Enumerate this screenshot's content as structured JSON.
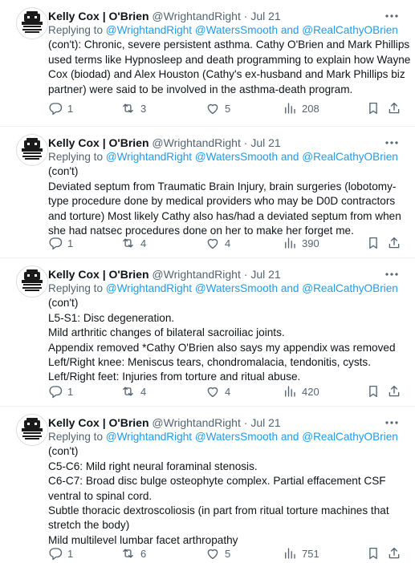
{
  "author": {
    "name": "Kelly Cox | O'Brien",
    "handle": "@WrightandRight",
    "separator": "·",
    "date": "Jul 21"
  },
  "reply": {
    "prefix": "Replying to",
    "mention1": "@WrightandRight",
    "mention2": "@WatersSmooth",
    "and": "and",
    "mention3": "@RealCathyOBrien"
  },
  "icons": {
    "more": "more-dots-icon",
    "reply": "reply-bubble-icon",
    "retweet": "retweet-icon",
    "like": "heart-icon",
    "views": "bar-chart-icon",
    "bookmark": "bookmark-icon",
    "share": "share-icon"
  },
  "colors": {
    "accent": "#1d9bf0",
    "muted": "#536471",
    "text": "#0f1419"
  },
  "tweets": [
    {
      "lines": [
        "(con't): Chronic, severe persistent asthma. Cathy O'Brien and Mark Phillips",
        "used terms like Hypnosleep and death programming to explain how Wayne",
        "Cox (biodad) and Alex Houston (Cathy's ex-husband and Mark Phillips biz",
        "partner) were said to be involved in the asthma-death program."
      ],
      "replies": "1",
      "retweets": "3",
      "likes": "5",
      "views": "208"
    },
    {
      "lines": [
        "(con't)",
        "Deviated septum from Traumatic Brain Injury, brain surgeries (lobotomy-",
        "type procedure done by medical providers who may be D0D contractors",
        "and torture) Most likely Cathy also has/had a deviated septum from when",
        "she had natsec procedures done on her to make her forget me."
      ],
      "replies": "1",
      "retweets": "4",
      "likes": "4",
      "views": "390"
    },
    {
      "lines": [
        "(con't)",
        "L5-S1: Disc degeneration.",
        "Mild arthritic changes of bilateral sacroiliac joints.",
        "Appendix removed *Cathy O'Brien also says my appendix was removed",
        "Left/Right knee: Meniscus tears, chondromalacia, tendonitis, cysts.",
        "Left/Right feet: Injuries from torture and ritual abuse."
      ],
      "replies": "1",
      "retweets": "4",
      "likes": "4",
      "views": "420"
    },
    {
      "lines": [
        "(con't)",
        "C5-C6: Mild right neural foraminal stenosis.",
        "C6-C7: Broad disc bulge osteophyte complex. Partial effacement CSF",
        "ventral to spinal cord.",
        "Subtle thoracic dextroscoliosis (in part from ritual torture machines that",
        "stretch the body)",
        "Mild multilevel lumbar facet arthropathy"
      ],
      "replies": "1",
      "retweets": "6",
      "likes": "5",
      "views": "751"
    }
  ]
}
